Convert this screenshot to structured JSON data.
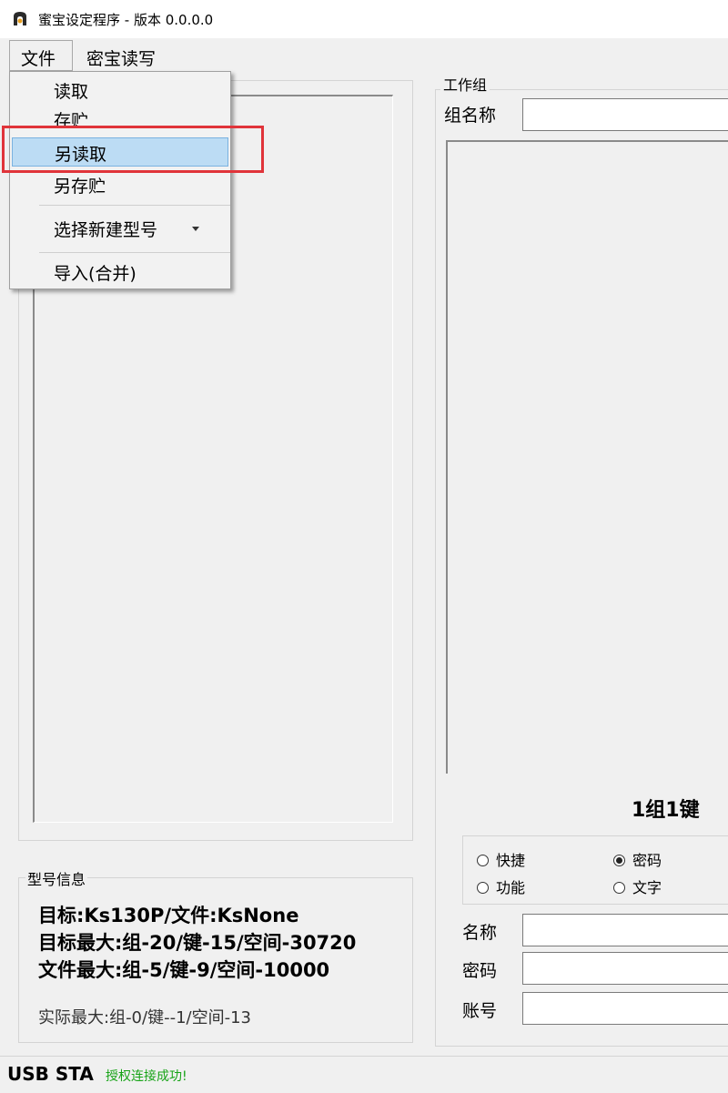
{
  "window": {
    "title": "蜜宝设定程序 - 版本 0.0.0.0"
  },
  "menubar": {
    "file": "文件",
    "read_write": "密宝读写"
  },
  "file_menu": {
    "items": [
      "读取",
      "存贮",
      "另读取",
      "另存贮",
      "选择新建型号",
      "导入(合并)"
    ],
    "highlighted": "另读取"
  },
  "model_info": {
    "legend": "型号信息",
    "target": "目标:Ks130P/文件:KsNone",
    "target_max": "目标最大:组-20/键-15/空间-30720",
    "file_max": "文件最大:组-5/键-9/空间-10000",
    "actual_max": "实际最大:组-0/键--1/空间-13"
  },
  "work_group": {
    "legend": "工作组",
    "group_name_label": "组名称",
    "group_name_value": "",
    "count_label": "1组1键",
    "types": [
      {
        "label": "快捷",
        "checked": false
      },
      {
        "label": "密码",
        "checked": true
      },
      {
        "label": "功能",
        "checked": false
      },
      {
        "label": "文字",
        "checked": false
      }
    ],
    "name_label": "名称",
    "password_label": "密码",
    "account_label": "账号"
  },
  "status": {
    "main": "USB STA",
    "message": "授权连接成功!",
    "message_color": "#17a317"
  },
  "colors": {
    "highlight_border": "#e0343a",
    "menu_hover": "#bcdcf4"
  }
}
